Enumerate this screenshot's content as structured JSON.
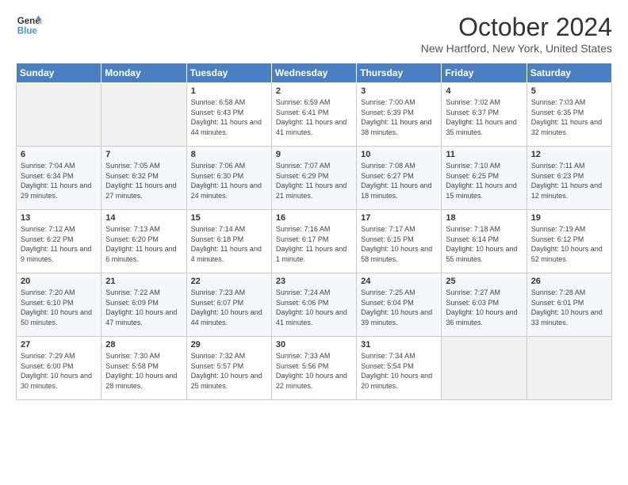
{
  "header": {
    "logo_line1": "General",
    "logo_line2": "Blue",
    "month_title": "October 2024",
    "subtitle": "New Hartford, New York, United States"
  },
  "days_of_week": [
    "Sunday",
    "Monday",
    "Tuesday",
    "Wednesday",
    "Thursday",
    "Friday",
    "Saturday"
  ],
  "weeks": [
    [
      {
        "num": "",
        "sunrise": "",
        "sunset": "",
        "daylight": ""
      },
      {
        "num": "",
        "sunrise": "",
        "sunset": "",
        "daylight": ""
      },
      {
        "num": "1",
        "sunrise": "Sunrise: 6:58 AM",
        "sunset": "Sunset: 6:43 PM",
        "daylight": "Daylight: 11 hours and 44 minutes."
      },
      {
        "num": "2",
        "sunrise": "Sunrise: 6:59 AM",
        "sunset": "Sunset: 6:41 PM",
        "daylight": "Daylight: 11 hours and 41 minutes."
      },
      {
        "num": "3",
        "sunrise": "Sunrise: 7:00 AM",
        "sunset": "Sunset: 6:39 PM",
        "daylight": "Daylight: 11 hours and 38 minutes."
      },
      {
        "num": "4",
        "sunrise": "Sunrise: 7:02 AM",
        "sunset": "Sunset: 6:37 PM",
        "daylight": "Daylight: 11 hours and 35 minutes."
      },
      {
        "num": "5",
        "sunrise": "Sunrise: 7:03 AM",
        "sunset": "Sunset: 6:35 PM",
        "daylight": "Daylight: 11 hours and 32 minutes."
      }
    ],
    [
      {
        "num": "6",
        "sunrise": "Sunrise: 7:04 AM",
        "sunset": "Sunset: 6:34 PM",
        "daylight": "Daylight: 11 hours and 29 minutes."
      },
      {
        "num": "7",
        "sunrise": "Sunrise: 7:05 AM",
        "sunset": "Sunset: 6:32 PM",
        "daylight": "Daylight: 11 hours and 27 minutes."
      },
      {
        "num": "8",
        "sunrise": "Sunrise: 7:06 AM",
        "sunset": "Sunset: 6:30 PM",
        "daylight": "Daylight: 11 hours and 24 minutes."
      },
      {
        "num": "9",
        "sunrise": "Sunrise: 7:07 AM",
        "sunset": "Sunset: 6:29 PM",
        "daylight": "Daylight: 11 hours and 21 minutes."
      },
      {
        "num": "10",
        "sunrise": "Sunrise: 7:08 AM",
        "sunset": "Sunset: 6:27 PM",
        "daylight": "Daylight: 11 hours and 18 minutes."
      },
      {
        "num": "11",
        "sunrise": "Sunrise: 7:10 AM",
        "sunset": "Sunset: 6:25 PM",
        "daylight": "Daylight: 11 hours and 15 minutes."
      },
      {
        "num": "12",
        "sunrise": "Sunrise: 7:11 AM",
        "sunset": "Sunset: 6:23 PM",
        "daylight": "Daylight: 11 hours and 12 minutes."
      }
    ],
    [
      {
        "num": "13",
        "sunrise": "Sunrise: 7:12 AM",
        "sunset": "Sunset: 6:22 PM",
        "daylight": "Daylight: 11 hours and 9 minutes."
      },
      {
        "num": "14",
        "sunrise": "Sunrise: 7:13 AM",
        "sunset": "Sunset: 6:20 PM",
        "daylight": "Daylight: 11 hours and 6 minutes."
      },
      {
        "num": "15",
        "sunrise": "Sunrise: 7:14 AM",
        "sunset": "Sunset: 6:18 PM",
        "daylight": "Daylight: 11 hours and 4 minutes."
      },
      {
        "num": "16",
        "sunrise": "Sunrise: 7:16 AM",
        "sunset": "Sunset: 6:17 PM",
        "daylight": "Daylight: 11 hours and 1 minute."
      },
      {
        "num": "17",
        "sunrise": "Sunrise: 7:17 AM",
        "sunset": "Sunset: 6:15 PM",
        "daylight": "Daylight: 10 hours and 58 minutes."
      },
      {
        "num": "18",
        "sunrise": "Sunrise: 7:18 AM",
        "sunset": "Sunset: 6:14 PM",
        "daylight": "Daylight: 10 hours and 55 minutes."
      },
      {
        "num": "19",
        "sunrise": "Sunrise: 7:19 AM",
        "sunset": "Sunset: 6:12 PM",
        "daylight": "Daylight: 10 hours and 52 minutes."
      }
    ],
    [
      {
        "num": "20",
        "sunrise": "Sunrise: 7:20 AM",
        "sunset": "Sunset: 6:10 PM",
        "daylight": "Daylight: 10 hours and 50 minutes."
      },
      {
        "num": "21",
        "sunrise": "Sunrise: 7:22 AM",
        "sunset": "Sunset: 6:09 PM",
        "daylight": "Daylight: 10 hours and 47 minutes."
      },
      {
        "num": "22",
        "sunrise": "Sunrise: 7:23 AM",
        "sunset": "Sunset: 6:07 PM",
        "daylight": "Daylight: 10 hours and 44 minutes."
      },
      {
        "num": "23",
        "sunrise": "Sunrise: 7:24 AM",
        "sunset": "Sunset: 6:06 PM",
        "daylight": "Daylight: 10 hours and 41 minutes."
      },
      {
        "num": "24",
        "sunrise": "Sunrise: 7:25 AM",
        "sunset": "Sunset: 6:04 PM",
        "daylight": "Daylight: 10 hours and 39 minutes."
      },
      {
        "num": "25",
        "sunrise": "Sunrise: 7:27 AM",
        "sunset": "Sunset: 6:03 PM",
        "daylight": "Daylight: 10 hours and 36 minutes."
      },
      {
        "num": "26",
        "sunrise": "Sunrise: 7:28 AM",
        "sunset": "Sunset: 6:01 PM",
        "daylight": "Daylight: 10 hours and 33 minutes."
      }
    ],
    [
      {
        "num": "27",
        "sunrise": "Sunrise: 7:29 AM",
        "sunset": "Sunset: 6:00 PM",
        "daylight": "Daylight: 10 hours and 30 minutes."
      },
      {
        "num": "28",
        "sunrise": "Sunrise: 7:30 AM",
        "sunset": "Sunset: 5:58 PM",
        "daylight": "Daylight: 10 hours and 28 minutes."
      },
      {
        "num": "29",
        "sunrise": "Sunrise: 7:32 AM",
        "sunset": "Sunset: 5:57 PM",
        "daylight": "Daylight: 10 hours and 25 minutes."
      },
      {
        "num": "30",
        "sunrise": "Sunrise: 7:33 AM",
        "sunset": "Sunset: 5:56 PM",
        "daylight": "Daylight: 10 hours and 22 minutes."
      },
      {
        "num": "31",
        "sunrise": "Sunrise: 7:34 AM",
        "sunset": "Sunset: 5:54 PM",
        "daylight": "Daylight: 10 hours and 20 minutes."
      },
      {
        "num": "",
        "sunrise": "",
        "sunset": "",
        "daylight": ""
      },
      {
        "num": "",
        "sunrise": "",
        "sunset": "",
        "daylight": ""
      }
    ]
  ]
}
